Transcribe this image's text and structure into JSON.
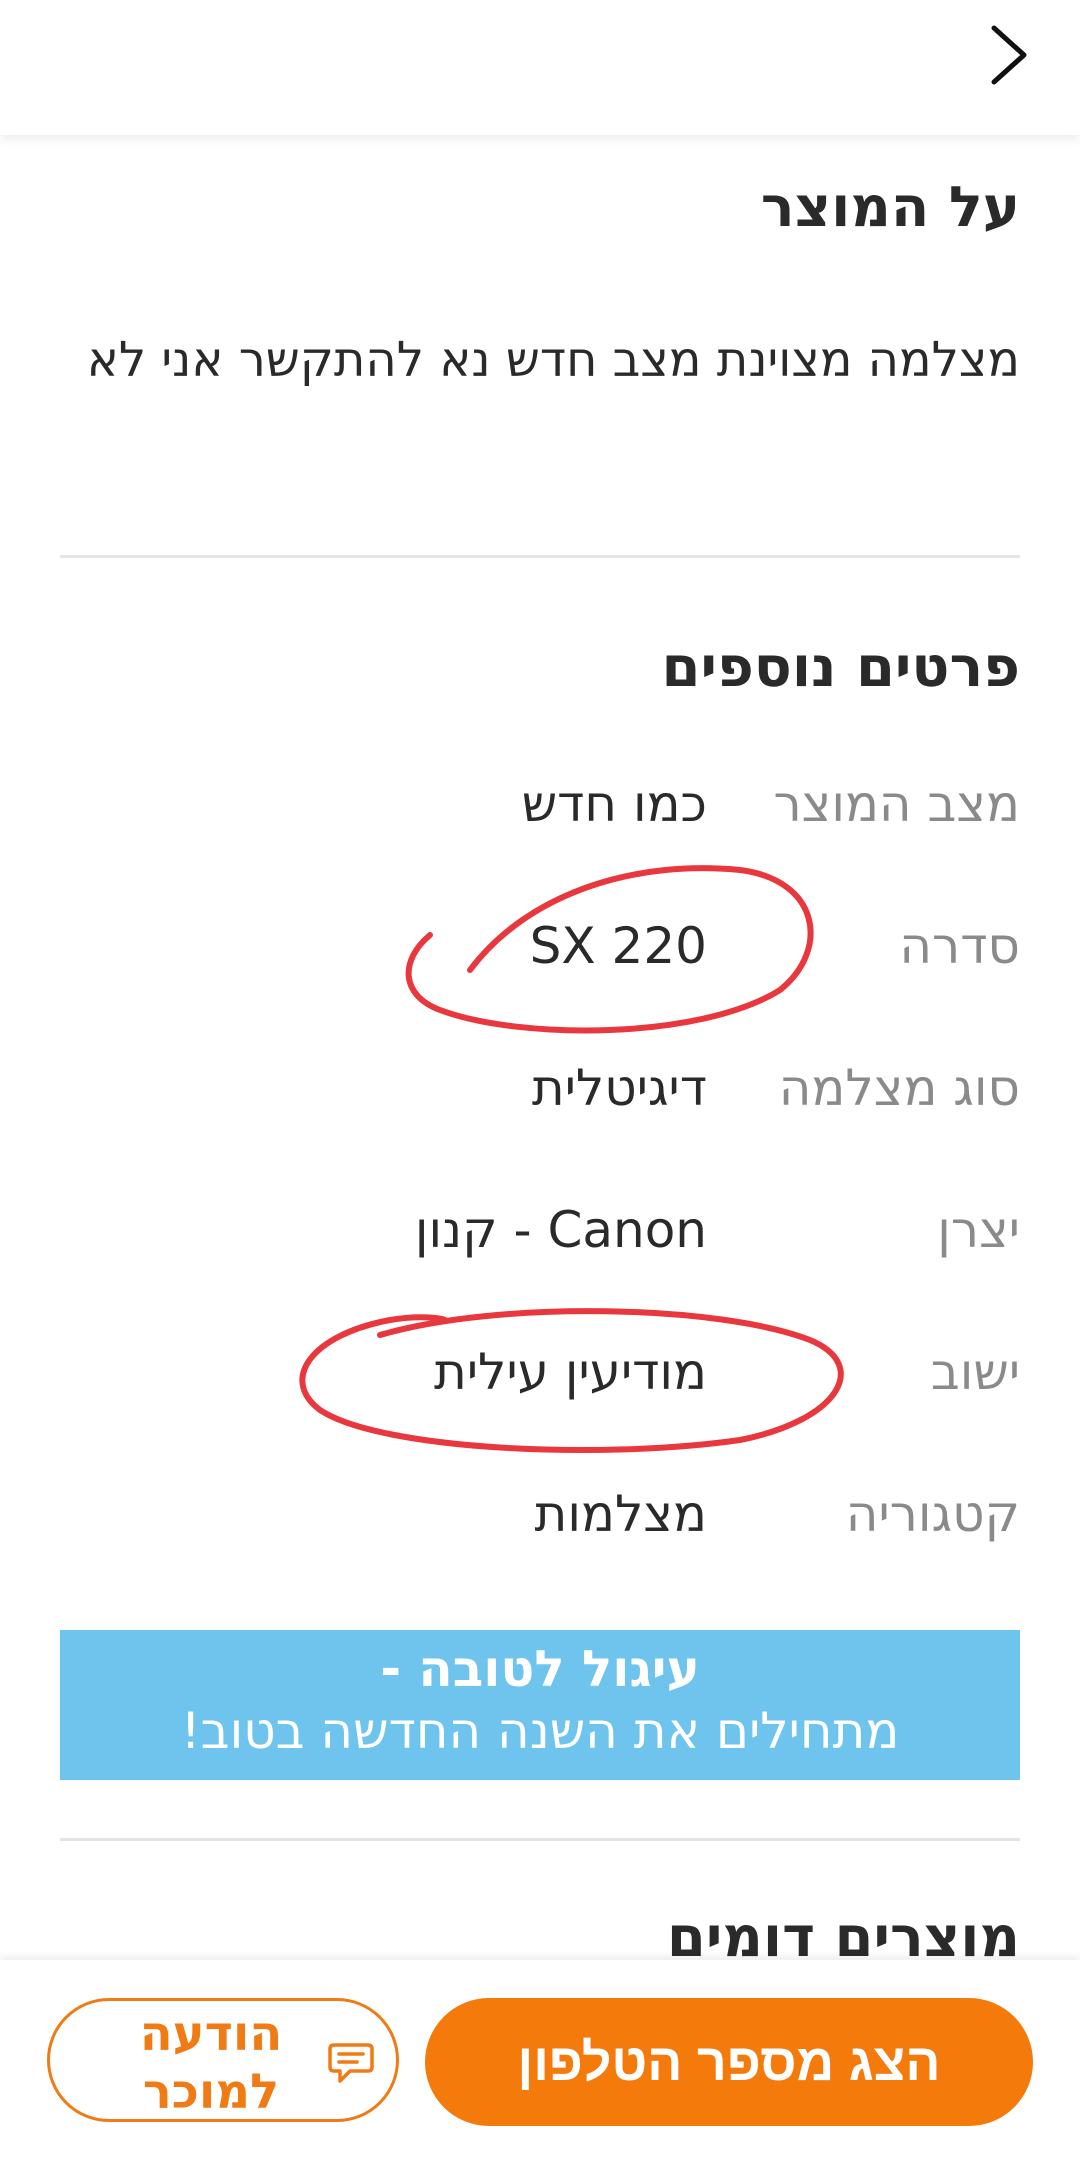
{
  "header": {
    "back_icon": "chevron-right-icon"
  },
  "about": {
    "title": "על המוצר",
    "description": "מצלמה מצוינת מצב חדש נא להתקשר אני לא"
  },
  "details": {
    "title": "פרטים נוספים",
    "rows": [
      {
        "label": "מצב המוצר",
        "value": "כמו חדש"
      },
      {
        "label": "סדרה",
        "value": "SX 220"
      },
      {
        "label": "סוג מצלמה",
        "value": "דיגיטלית"
      },
      {
        "label": "יצרן",
        "value": "Canon - קנון"
      },
      {
        "label": "ישוב",
        "value": "מודיעין עילית"
      },
      {
        "label": "קטגוריה",
        "value": "מצלמות"
      }
    ]
  },
  "banner": {
    "line1": "עיגול לטובה -",
    "line2": "מתחילים את השנה החדשה בטוב!",
    "color": "#6ec4ec"
  },
  "similar": {
    "title": "מוצרים דומים"
  },
  "actions": {
    "show_phone_label": "הצג מספר הטלפון",
    "message_label": "הודעה למוכר",
    "message_icon": "chat-bubble-icon",
    "accent_color": "#f57a0c"
  },
  "annotation_color": "#e8383d"
}
